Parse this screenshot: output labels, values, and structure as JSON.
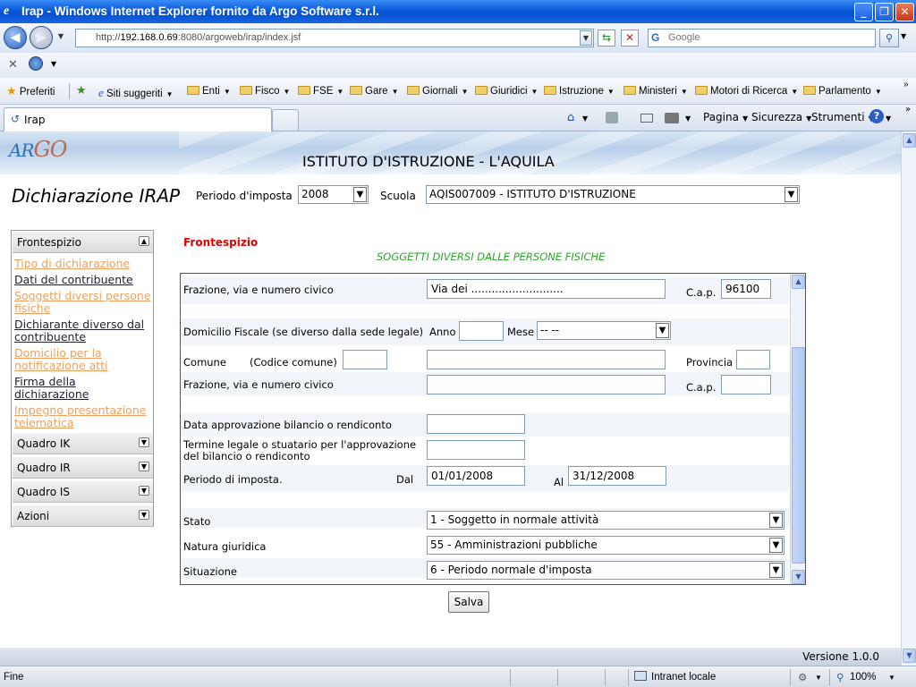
{
  "window": {
    "title": "Irap - Windows Internet Explorer fornito da Argo Software s.r.l.",
    "minimize": "_",
    "maximize": "❐",
    "close": "✕"
  },
  "address": {
    "url_prefix": "http://",
    "url_host": "192.168.0.69",
    "url_rest": ":8080/argoweb/irap/index.jsf",
    "search_placeholder": "Google"
  },
  "favorites": {
    "favorites_label": "Preferiti",
    "items": [
      "Siti suggeriti",
      "Enti",
      "Fisco",
      "FSE",
      "Gare",
      "Giornali",
      "Giuridici",
      "Istruzione",
      "Ministeri",
      "Motori di Ricerca",
      "Parlamento"
    ]
  },
  "tab": {
    "label": "Irap"
  },
  "commands": {
    "pagina": "Pagina",
    "sicurezza": "Sicurezza",
    "strumenti": "Strumenti"
  },
  "app": {
    "logo_a": "AR",
    "logo_b": "GO",
    "school_title": "ISTITUTO D'ISTRUZIONE - L'AQUILA",
    "page_title": "Dichiarazione IRAP",
    "periodo_label": "Periodo d'imposta",
    "periodo_value": "2008",
    "scuola_label": "Scuola",
    "scuola_value": "AQIS007009 - ISTITUTO D'ISTRUZIONE"
  },
  "sidebar": {
    "frontespizio": "Frontespizio",
    "links": [
      {
        "label": "Tipo di dichiarazione",
        "state": "visited"
      },
      {
        "label": "Dati del contribuente",
        "state": "normal"
      },
      {
        "label": "Soggetti diversi persone fisiche",
        "state": "visited"
      },
      {
        "label": "Dichiarante diverso dal contribuente",
        "state": "normal"
      },
      {
        "label": "Domicilio per la notificazione atti",
        "state": "visited"
      },
      {
        "label": "Firma della dichiarazione",
        "state": "normal"
      },
      {
        "label": "Impegno presentazione telematica",
        "state": "visited"
      }
    ],
    "sections": [
      "Quadro IK",
      "Quadro IR",
      "Quadro IS",
      "Azioni"
    ]
  },
  "form": {
    "section_title": "Frontespizio",
    "subtitle": "SOGGETTI DIVERSI DALLE PERSONE FISICHE",
    "r1_label": "Frazione, via e numero civico",
    "r1_value": "Via dei ...........................",
    "cap_label": "C.a.p.",
    "cap1_value": "96100",
    "domicilio_label": "Domicilio Fiscale (se diverso dalla sede legale)",
    "anno_label": "Anno",
    "anno_value": "",
    "mese_label": "Mese",
    "mese_value": "-- --",
    "comune_label": "Comune",
    "codice_comune_label": "(Codice comune)",
    "codice_comune_value": "",
    "comune_value": "",
    "provincia_label": "Provincia",
    "provincia_value": "",
    "r2_label": "Frazione, via e numero civico",
    "r2_value": "",
    "cap2_value": "",
    "data_appr_label": "Data approvazione bilancio o rendiconto",
    "data_appr_value": "",
    "termine_label": "Termine legale o stuatario per l'approvazione del bilancio o rendiconto",
    "termine_value": "",
    "periodo_label": "Periodo di imposta.",
    "dal_label": "Dal",
    "dal_value": "01/01/2008",
    "al_label": "Al",
    "al_value": "31/12/2008",
    "stato_label": "Stato",
    "stato_value": "1 - Soggetto in normale attività",
    "natura_label": "Natura giuridica",
    "natura_value": "55 - Amministrazioni pubbliche",
    "situazione_label": "Situazione",
    "situazione_value": "6 - Periodo normale d'imposta",
    "save_label": "Salva"
  },
  "footer": {
    "version": "Versione 1.0.0"
  },
  "status": {
    "left": "Fine",
    "zone": "Intranet locale",
    "zoom": "100%"
  }
}
